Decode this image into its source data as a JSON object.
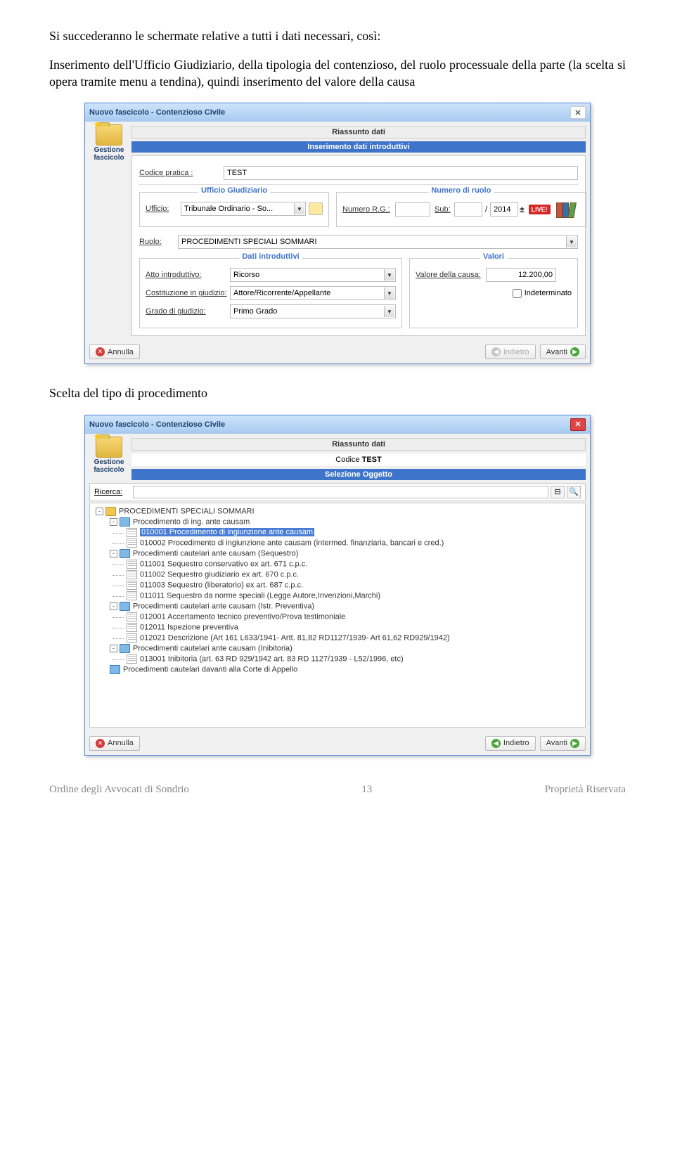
{
  "doc": {
    "p1": "Si succederanno le schermate relative a tutti i dati necessari, così:",
    "p2": "Inserimento dell'Ufficio Giudiziario, della tipologia del contenzioso, del ruolo processuale della parte (la scelta si opera tramite menu a tendina), quindi inserimento del valore della causa",
    "p3": "Scelta del tipo di procedimento"
  },
  "dlg1": {
    "title": "Nuovo fascicolo - Contenzioso Civile",
    "gestione_l1": "Gestione",
    "gestione_l2": "fascicolo",
    "riassunto": "Riassunto dati",
    "section_header": "Inserimento dati introduttivi",
    "codice_lbl": "Codice pratica :",
    "codice_val": "TEST",
    "ufficio_legend": "Ufficio Giudiziario",
    "ufficio_lbl": "Ufficio:",
    "ufficio_val": "Tribunale Ordinario - So...",
    "ruolo_legend": "Numero di ruolo",
    "numero_lbl": "Numero R.G.:",
    "numero_val": "",
    "sub_lbl": "Sub:",
    "sub_val": "",
    "year_val": "2014",
    "live": "LIVE!",
    "ruolo_lbl": "Ruolo:",
    "ruolo_val": "PROCEDIMENTI SPECIALI SOMMARI",
    "dati_legend": "Dati introduttivi",
    "atto_lbl": "Atto introduttivo:",
    "atto_val": "Ricorso",
    "cost_lbl": "Costituzione in giudizio:",
    "cost_val": "Attore/Ricorrente/Appellante",
    "grado_lbl": "Grado di giudizio:",
    "grado_val": "Primo Grado",
    "valori_legend": "Valori",
    "valore_lbl": "Valore della causa:",
    "valore_val": "12.200,00",
    "indeterminato": "Indeterminato",
    "btn_annulla": "Annulla",
    "btn_indietro": "Indietro",
    "btn_avanti": "Avanti"
  },
  "dlg2": {
    "title": "Nuovo fascicolo - Contenzioso Civile",
    "gestione_l1": "Gestione",
    "gestione_l2": "fascicolo",
    "riassunto": "Riassunto dati",
    "codice_lbl": "Codice",
    "codice_val": "TEST",
    "section_header": "Selezione Oggetto",
    "ricerca_lbl": "Ricerca:",
    "ricerca_val": "",
    "tree": [
      {
        "level": 0,
        "exp": "-",
        "type": "folder",
        "text": "PROCEDIMENTI SPECIALI SOMMARI"
      },
      {
        "level": 1,
        "exp": "-",
        "type": "folder-blue",
        "text": "Procedimento di ing. ante causam"
      },
      {
        "level": 2,
        "type": "page",
        "text": "010001 Procedimento di ingiunzione ante causam",
        "selected": true
      },
      {
        "level": 2,
        "type": "page",
        "text": "010002 Procedimento di ingiunzione ante causam (intermed. finanziaria, bancari e cred.)"
      },
      {
        "level": 1,
        "exp": "-",
        "type": "folder-blue",
        "text": "Procedimenti cautelari ante causam (Sequestro)"
      },
      {
        "level": 2,
        "type": "page",
        "text": "011001 Sequestro conservativo ex art. 671 c.p.c."
      },
      {
        "level": 2,
        "type": "page",
        "text": "011002 Sequestro giudiziario ex art. 670 c.p.c."
      },
      {
        "level": 2,
        "type": "page",
        "text": "011003 Sequestro (liberatorio) ex art. 687 c.p.c."
      },
      {
        "level": 2,
        "type": "page",
        "text": "011011 Sequestro da norme speciali (Legge Autore,Invenzioni,Marchi)"
      },
      {
        "level": 1,
        "exp": "-",
        "type": "folder-blue",
        "text": "Procedimenti cautelari ante causam (Istr. Preventiva)"
      },
      {
        "level": 2,
        "type": "page",
        "text": "012001 Accertamento tecnico preventivo/Prova testimoniale"
      },
      {
        "level": 2,
        "type": "page",
        "text": "012011 Ispezione preventiva"
      },
      {
        "level": 2,
        "type": "page",
        "text": "012021 Descrizione (Art 161 L633/1941- Artt. 81,82 RD1127/1939- Art 61,62 RD929/1942)"
      },
      {
        "level": 1,
        "exp": "-",
        "type": "folder-blue",
        "text": "Procedimenti cautelari ante causam (Inibitoria)"
      },
      {
        "level": 2,
        "type": "page",
        "text": "013001 Inibitoria (art. 63 RD 929/1942 art. 83 RD 1127/1939 - L52/1996, etc)"
      },
      {
        "level": 1,
        "exp": "",
        "type": "folder-blue",
        "text": "Procedimenti cautelari davanti alla Corte di Appello"
      }
    ],
    "btn_annulla": "Annulla",
    "btn_indietro": "Indietro",
    "btn_avanti": "Avanti"
  },
  "footer": {
    "left": "Ordine degli Avvocati di Sondrio",
    "center": "13",
    "right": "Proprietà Riservata"
  }
}
